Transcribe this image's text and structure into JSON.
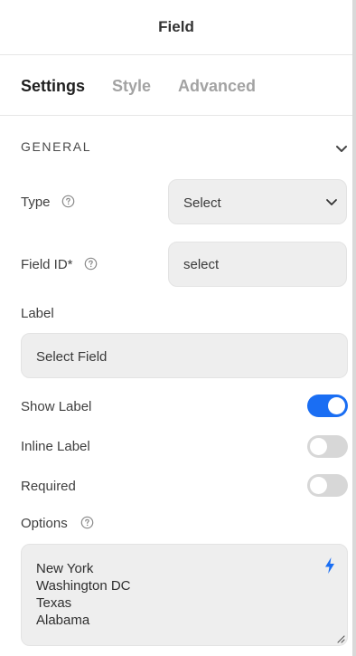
{
  "header": {
    "title": "Field"
  },
  "tabs": [
    {
      "label": "Settings"
    },
    {
      "label": "Style"
    },
    {
      "label": "Advanced"
    }
  ],
  "section": {
    "title": "GENERAL"
  },
  "fields": {
    "type": {
      "label": "Type",
      "value": "Select"
    },
    "field_id": {
      "label": "Field ID*",
      "value": "select"
    },
    "label": {
      "label": "Label",
      "value": "Select Field"
    },
    "show_label": {
      "label": "Show Label",
      "on": true
    },
    "inline_label": {
      "label": "Inline Label",
      "on": false
    },
    "required": {
      "label": "Required",
      "on": false
    },
    "options": {
      "label": "Options",
      "lines": [
        "New York",
        "Washington DC",
        "Texas",
        "Alabama"
      ]
    }
  },
  "colors": {
    "accent": "#1a6ef3",
    "toggle_off": "#d7d7d7",
    "input_bg": "#eeeeee"
  },
  "icons": {
    "help": "help-circle-icon",
    "chevron": "chevron-down-icon",
    "dynamic": "lightning-bolt-icon",
    "resize": "resize-grip-icon"
  }
}
